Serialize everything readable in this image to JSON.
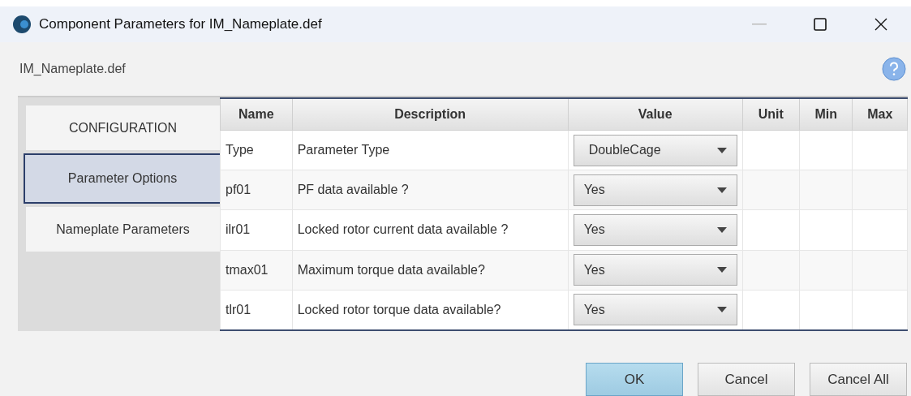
{
  "window": {
    "title": "Component Parameters for IM_Nameplate.def"
  },
  "file_name": "IM_Nameplate.def",
  "tabs": [
    {
      "label": "CONFIGURATION",
      "selected": false
    },
    {
      "label": "Parameter Options",
      "selected": true
    },
    {
      "label": "Nameplate Parameters",
      "selected": false
    }
  ],
  "table": {
    "columns": [
      "Name",
      "Description",
      "Value",
      "Unit",
      "Min",
      "Max"
    ],
    "rows": [
      {
        "name": "Type",
        "description": "Parameter Type",
        "value": "DoubleCage"
      },
      {
        "name": "pf01",
        "description": "PF data available ?",
        "value": "Yes"
      },
      {
        "name": "ilr01",
        "description": "Locked rotor current data available ?",
        "value": "Yes"
      },
      {
        "name": "tmax01",
        "description": "Maximum torque data available?",
        "value": "Yes"
      },
      {
        "name": "tlr01",
        "description": "Locked rotor torque data available?",
        "value": "Yes"
      }
    ]
  },
  "buttons": [
    {
      "label": "OK",
      "kind": "default"
    },
    {
      "label": "Cancel",
      "kind": "normal"
    },
    {
      "label": "Cancel All",
      "kind": "normal"
    }
  ]
}
